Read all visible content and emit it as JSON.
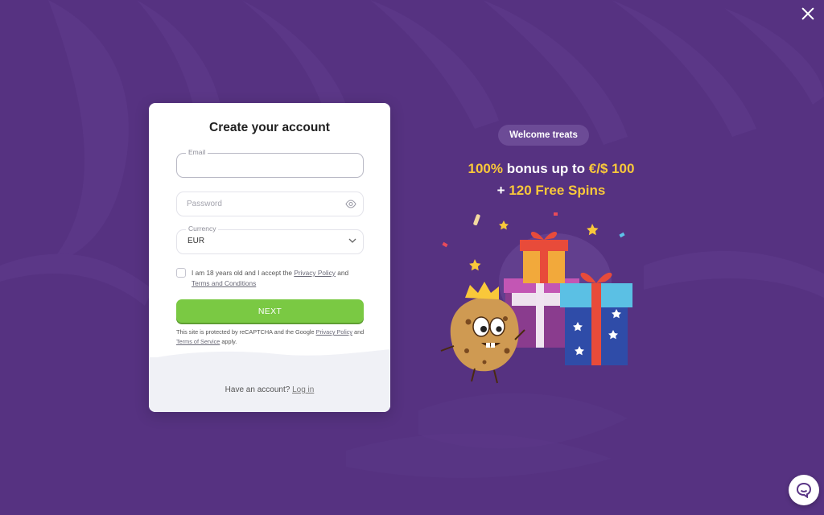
{
  "form": {
    "title": "Create your account",
    "email": {
      "label": "Email",
      "value": ""
    },
    "password": {
      "placeholder": "Password"
    },
    "currency": {
      "label": "Currency",
      "value": "EUR"
    },
    "consent": {
      "prefix": "I am 18 years old and I accept the",
      "privacy_link": "Privacy Policy",
      "and": "and",
      "terms_link": "Terms and Conditions"
    },
    "next_label": "NEXT",
    "recaptcha": {
      "prefix": "This site is protected by reCAPTCHA and the Google",
      "privacy_link": "Privacy Policy",
      "and": "and",
      "terms_link": "Terms of Service",
      "suffix": "apply."
    },
    "footer": {
      "question": "Have an account?",
      "login_link": "Log in"
    }
  },
  "promo": {
    "badge": "Welcome treats",
    "line1_highlight_a": "100%",
    "line1_text": "bonus up to",
    "line1_highlight_b": "€/$ 100",
    "line2_prefix": "+",
    "line2_highlight": "120 Free Spins"
  },
  "colors": {
    "background": "#563281",
    "accent_green": "#7ac943",
    "highlight_yellow": "#f9c83a",
    "badge_purple": "#6c4b96"
  },
  "icons": [
    "close-icon",
    "eye-icon",
    "chevron-down-icon",
    "chat-icon"
  ]
}
